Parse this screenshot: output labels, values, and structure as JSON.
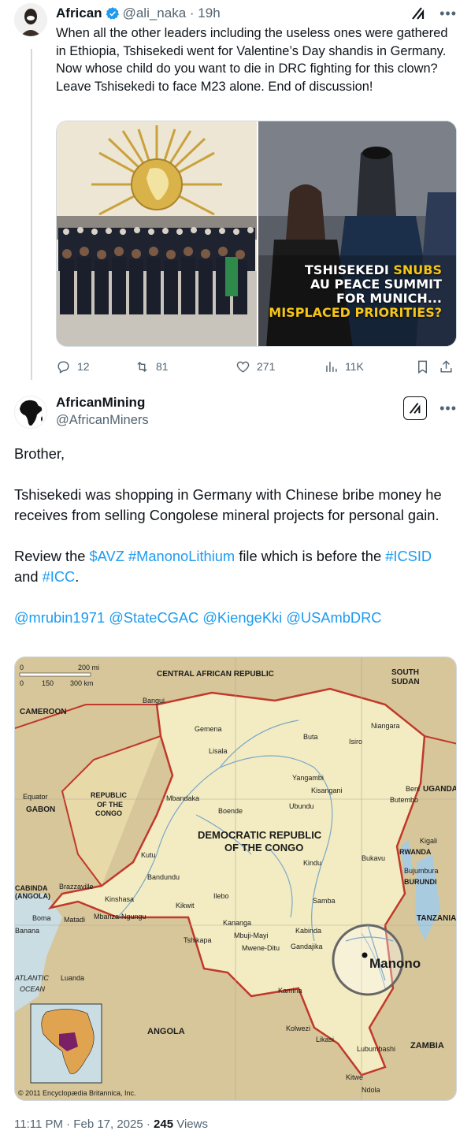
{
  "tweet1": {
    "author_name": "African",
    "handle": "@ali_naka",
    "time": "19h",
    "text": "When all the other leaders including the useless ones were gathered in Ethiopia, Tshisekedi went for Valentine’s Day shandis in Germany. Now whose child do you want to die in DRC fighting for this clown? Leave Tshisekedi to face M23 alone. End of discussion!",
    "image_caption": {
      "line1_a": "TSHISEKEDI ",
      "line1_b": "SNUBS",
      "line2": "AU PEACE SUMMIT",
      "line3": "FOR MUNICH...",
      "line4": "MISPLACED PRIORITIES?"
    },
    "replies": "12",
    "reposts": "81",
    "likes": "271",
    "views": "11K"
  },
  "tweet2": {
    "author_name": "AfricanMining",
    "handle": "@AfricanMiners",
    "para1": "Brother,",
    "para2": "Tshisekedi was shopping in Germany with Chinese bribe money he receives from selling Congolese mineral projects for personal gain.",
    "para3_a": "Review the ",
    "cashtag": "$AVZ",
    "hashtag1": "#ManonoLithium",
    "para3_b": " file which is before the ",
    "hashtag2": "#ICSID",
    "para3_c": " and ",
    "hashtag3": "#ICC",
    "para3_d": ".",
    "mentions": [
      "@mrubin1971",
      "@StateCGAC",
      "@KiengeKki",
      "@USAmbDRC"
    ],
    "map": {
      "scale_top": "200 mi",
      "scale_km_0": "0",
      "scale_km_150": "150",
      "scale_km_300": "300 km",
      "scale_zero": "0",
      "car": "CENTRAL AFRICAN REPUBLIC",
      "south_sudan": "SOUTH SUDAN",
      "cameroon": "CAMEROON",
      "equator": "Equator",
      "gabon": "GABON",
      "roc": "REPUBLIC OF THE CONGO",
      "drc": "DEMOCRATIC REPUBLIC OF THE CONGO",
      "uganda": "UGANDA",
      "rwanda": "RWANDA",
      "burundi": "BURUNDI",
      "tanzania": "TANZANIA",
      "angola_left": "CABINDA (ANGOLA)",
      "angola": "ANGOLA",
      "zambia": "ZAMBIA",
      "atlantic": "ATLANTIC OCEAN",
      "manono": "Manono",
      "copyright": "© 2011 Encyclopædia Britannica, Inc.",
      "towns": [
        "Bangui",
        "Gemena",
        "Buta",
        "Niangara",
        "Isiro",
        "Lisala",
        "Yangambi",
        "Kisangani",
        "Beni",
        "Butembo",
        "Mbandaka",
        "Boende",
        "Ubundu",
        "Kutu",
        "Kindu",
        "Bukavu",
        "Kigali",
        "Bujumbura",
        "Bandundu",
        "Brazzaville",
        "Kinshasa",
        "Ilebo",
        "Kikwit",
        "Samba",
        "Boma",
        "Matadi",
        "Mbanza-Ngungu",
        "Banana",
        "Kananga",
        "Mbuji-Mayi",
        "Kabinda",
        "Tshikapa",
        "Mwene-Ditu",
        "Gandajika",
        "Luanda",
        "Kamina",
        "Kolwezi",
        "Likasi",
        "Lubumbashi",
        "Kitwe",
        "Ndola"
      ]
    },
    "timestamp": "11:11 PM · Feb 17, 2025 · ",
    "views_count": "245",
    "views_label": " Views"
  },
  "colors": {
    "link": "#1d9bf0",
    "muted": "#536471",
    "map_land": "#f3ecc2",
    "map_neighbors": "#d8c89e",
    "map_water": "#c9dde3",
    "border_red": "#c0392b"
  }
}
